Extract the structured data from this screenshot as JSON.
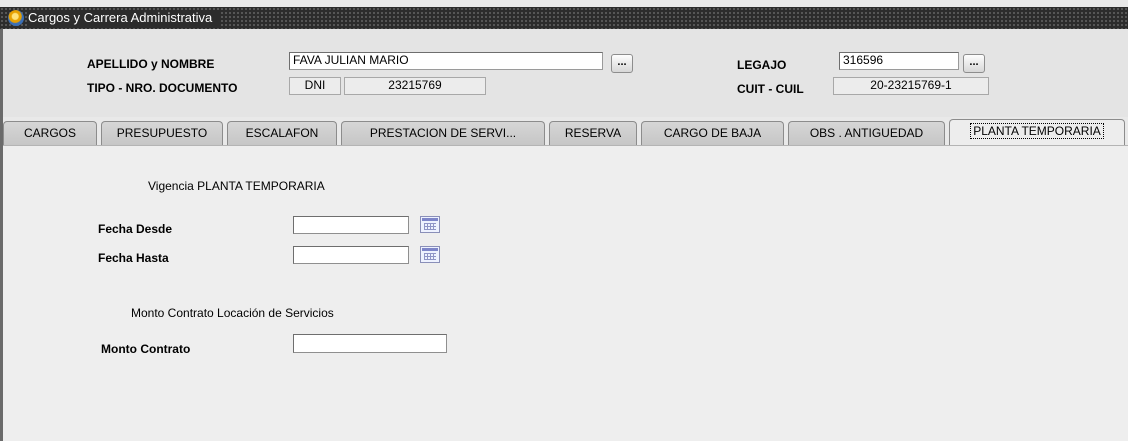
{
  "window": {
    "title": "Cargos y Carrera Administrativa"
  },
  "header": {
    "apellido_label": "APELLIDO y NOMBRE",
    "apellido_value": "FAVA JULIAN MARIO",
    "legajo_label": "LEGAJO",
    "legajo_value": "316596",
    "tipo_label": "TIPO - NRO. DOCUMENTO",
    "tipo_value": "DNI",
    "nro_value": "23215769",
    "cuit_label": "CUIT - CUIL",
    "cuit_value": "20-23215769-1",
    "lookup_label": "..."
  },
  "tabs": [
    {
      "label": "CARGOS"
    },
    {
      "label": "PRESUPUESTO"
    },
    {
      "label": "ESCALAFON"
    },
    {
      "label": "PRESTACION DE SERVI..."
    },
    {
      "label": "RESERVA"
    },
    {
      "label": "CARGO DE BAJA"
    },
    {
      "label": "OBS . ANTIGUEDAD"
    },
    {
      "label": "PLANTA TEMPORARIA",
      "active": true
    }
  ],
  "content": {
    "vigencia_title": "Vigencia PLANTA TEMPORARIA",
    "fecha_desde_label": "Fecha Desde",
    "fecha_desde_value": "",
    "fecha_hasta_label": "Fecha Hasta",
    "fecha_hasta_value": "",
    "monto_title": "Monto Contrato Locación de Servicios",
    "monto_label": "Monto Contrato",
    "monto_value": ""
  },
  "icons": {
    "app": "app-logo-icon",
    "calendar": "calendar-icon"
  }
}
